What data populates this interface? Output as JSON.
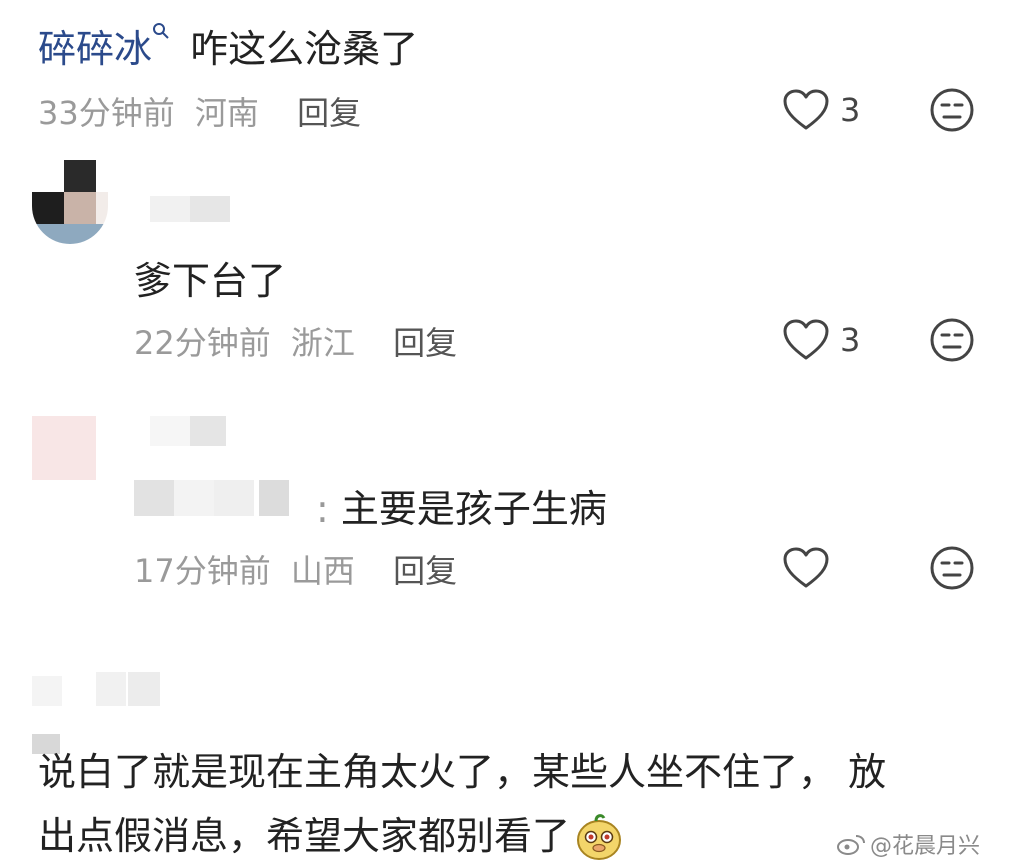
{
  "comments": [
    {
      "mention_user": "碎碎冰",
      "text": "咋这么沧桑了",
      "time": "33分钟前",
      "location": "河南",
      "reply_label": "回复",
      "likes": "3"
    },
    {
      "text": "爹下台了",
      "time": "22分钟前",
      "location": "浙江",
      "reply_label": "回复",
      "likes": "3"
    },
    {
      "text": "主要是孩子生病",
      "time": "17分钟前",
      "location": "山西",
      "reply_label": "回复",
      "likes": ""
    },
    {
      "text_line1": "说白了就是现在主角太火了，某些人坐不住了，  放",
      "text_line2": "出点假消息，希望大家都别看了"
    }
  ],
  "watermark": "@花晨月兴",
  "colors": {
    "mention": "#2b4a8b",
    "meta": "#9a9a9a",
    "icon": "#444444"
  },
  "icons": [
    "search-small-icon",
    "heart-icon",
    "neutral-face-icon",
    "emoji-face-icon",
    "weibo-logo-icon"
  ]
}
